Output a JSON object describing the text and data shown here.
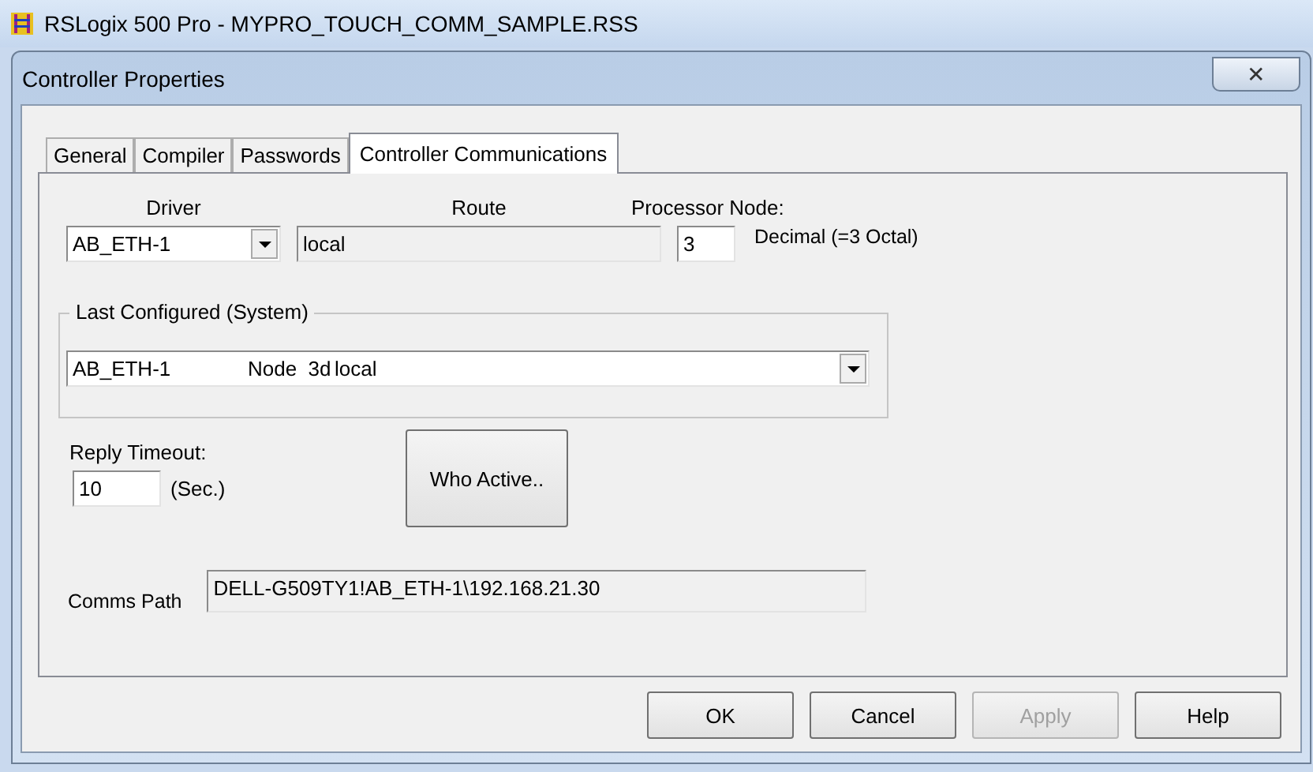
{
  "app_window": {
    "title": "RSLogix 500 Pro - MYPRO_TOUCH_COMM_SAMPLE.RSS"
  },
  "dialog": {
    "title": "Controller Properties",
    "close": "✕"
  },
  "tabs": [
    {
      "label": "General",
      "selected": false
    },
    {
      "label": "Compiler",
      "selected": false
    },
    {
      "label": "Passwords",
      "selected": false
    },
    {
      "label": "Controller Communications",
      "selected": true
    }
  ],
  "driver": {
    "label": "Driver",
    "value": "AB_ETH-1"
  },
  "route": {
    "label": "Route",
    "value": "local"
  },
  "processor_node": {
    "label": "Processor Node:",
    "value": "3",
    "note": "Decimal (=3 Octal)"
  },
  "last_configured": {
    "label": "Last Configured (System)",
    "driver": "AB_ETH-1",
    "node": "Node  3d",
    "route": "local"
  },
  "reply_timeout": {
    "label": "Reply Timeout:",
    "value": "10",
    "unit": "(Sec.)"
  },
  "who_active_button": "Who Active..",
  "comms_path": {
    "label": "Comms Path",
    "value": "DELL-G509TY1!AB_ETH-1\\192.168.21.30"
  },
  "buttons": [
    {
      "label": "OK",
      "disabled": false
    },
    {
      "label": "Cancel",
      "disabled": false
    },
    {
      "label": "Apply",
      "disabled": true
    },
    {
      "label": "Help",
      "disabled": false
    }
  ]
}
